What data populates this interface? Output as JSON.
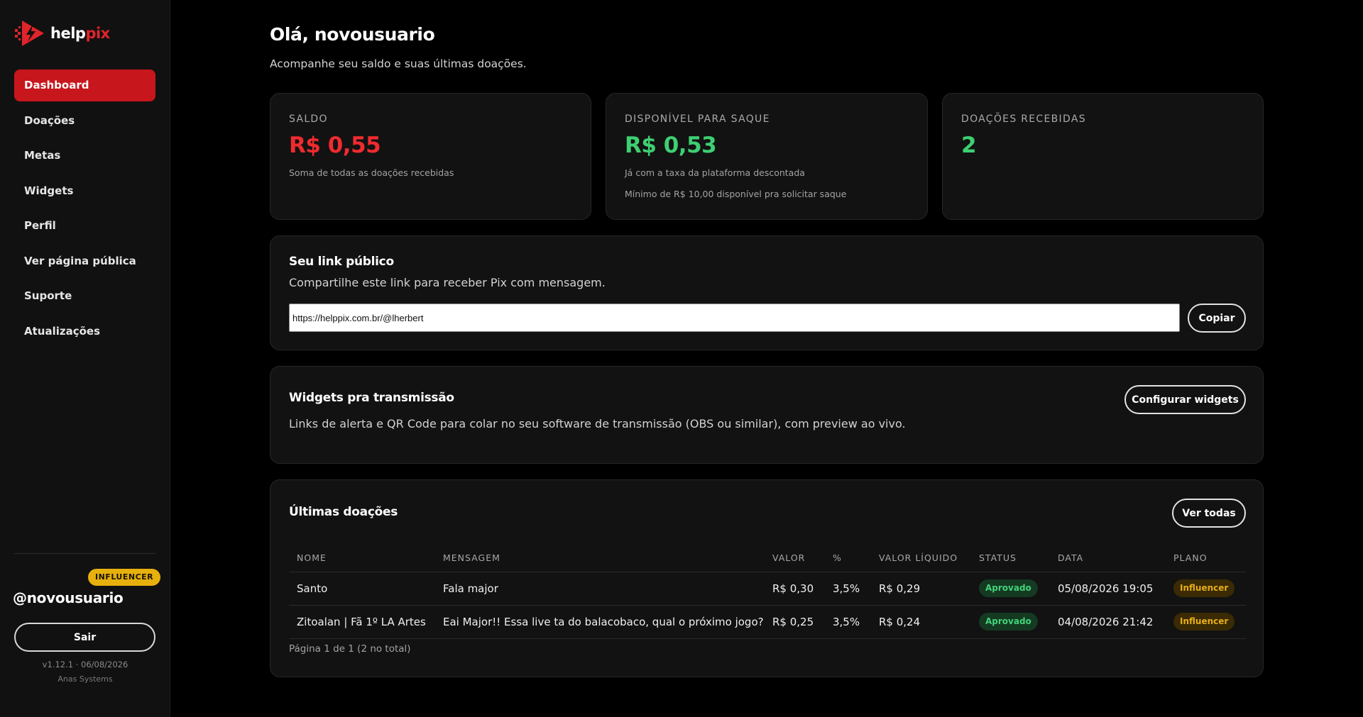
{
  "brand": {
    "name_white": "help",
    "name_red": "pix",
    "logo_icon": "play-bolt-icon",
    "red": "#e0242a"
  },
  "sidebar": {
    "items": [
      {
        "label": "Dashboard",
        "active": true
      },
      {
        "label": "Doações"
      },
      {
        "label": "Metas"
      },
      {
        "label": "Widgets"
      },
      {
        "label": "Perfil"
      },
      {
        "label": "Ver página pública"
      },
      {
        "label": "Suporte"
      },
      {
        "label": "Atualizações"
      }
    ],
    "plan_badge": "INFLUENCER",
    "username": "@novousuario",
    "logout_label": "Sair",
    "version": "v1.12.1 · 06/08/2026",
    "company": "Anas Systems"
  },
  "header": {
    "title": "Olá, novousuario",
    "subtitle": "Acompanhe seu saldo e suas últimas doações."
  },
  "stats": {
    "saldo": {
      "label": "SALDO",
      "value": "R$ 0,55",
      "note": "Soma de todas as doações recebidas",
      "color": "#ef2b2f"
    },
    "disponivel": {
      "label": "DISPONÍVEL PARA SAQUE",
      "value": "R$ 0,53",
      "note1": "Já com a taxa da plataforma descontada",
      "note2": "Mínimo de R$ 10,00 disponível pra solicitar saque",
      "color": "#3ecf72"
    },
    "recebidas": {
      "label": "DOAÇÕES RECEBIDAS",
      "value": "2",
      "color": "#3ecf72"
    }
  },
  "public_link": {
    "title": "Seu link público",
    "description": "Compartilhe este link para receber Pix com mensagem.",
    "url": "https://helppix.com.br/@lherbert",
    "copy_label": "Copiar"
  },
  "widgets": {
    "title": "Widgets pra transmissão",
    "description": "Links de alerta e QR Code para colar no seu software de transmissão (OBS ou similar), com preview ao vivo.",
    "button_label": "Configurar widgets"
  },
  "donations": {
    "title": "Últimas doações",
    "view_all_label": "Ver todas",
    "columns": [
      "NOME",
      "MENSAGEM",
      "VALOR",
      "%",
      "VALOR LÍQUIDO",
      "STATUS",
      "DATA",
      "PLANO"
    ],
    "rows": [
      {
        "nome": "Santo",
        "mensagem": "Fala major",
        "valor": "R$ 0,30",
        "pct": "3,5%",
        "liquido": "R$ 0,29",
        "status": "Aprovado",
        "data": "05/08/2026 19:05",
        "plano": "Influencer"
      },
      {
        "nome": "Zitoalan | Fã 1º LA Artes",
        "mensagem": "Eai Major!! Essa live ta do balacobaco, qual o próximo jogo?",
        "valor": "R$ 0,25",
        "pct": "3,5%",
        "liquido": "R$ 0,24",
        "status": "Aprovado",
        "data": "04/08/2026 21:42",
        "plano": "Influencer"
      }
    ],
    "pagination": "Página 1 de 1 (2 no total)"
  }
}
